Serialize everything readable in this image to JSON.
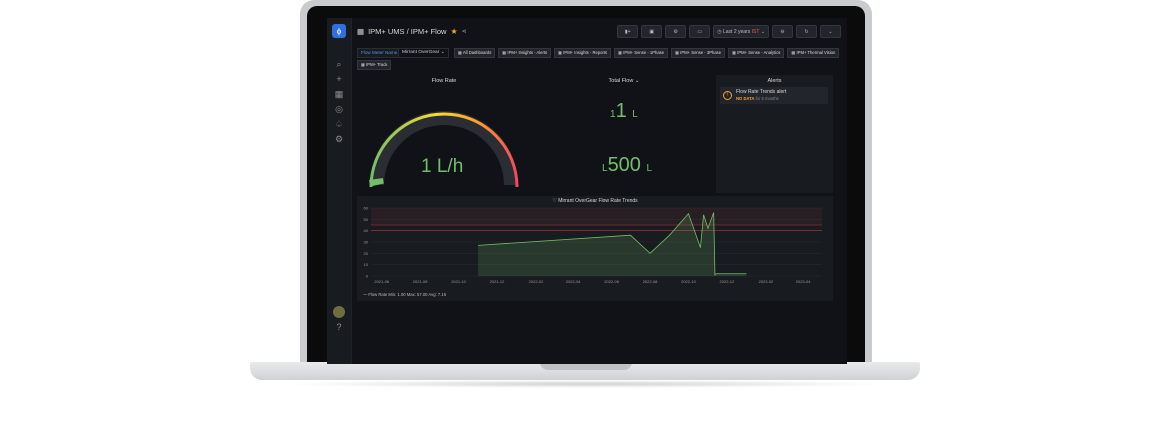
{
  "header": {
    "breadcrumb": "IPM+ UMS / IPM+ Flow",
    "time_range": "Last 2 years",
    "time_zone": "IST"
  },
  "variables": {
    "label": "Flow Meter Name",
    "value": "Mirrant OverGear"
  },
  "links": [
    "All Dashboards",
    "IPM+ Insights - Alerts",
    "IPM+ Insights - Reports",
    "IPM+ Sense - 1Phase",
    "IPM+ Sense - 3Phase",
    "IPM+ Sense - Analytics",
    "IPM+ Thermal Vision"
  ],
  "links_row2": [
    "IPM+ Track"
  ],
  "panels": {
    "gauge": {
      "title": "Flow Rate",
      "value": "1 L/h"
    },
    "total_flow": {
      "title": "Total Flow",
      "value1_prefix": "1",
      "value1": "1",
      "value1_unit": "L",
      "value2_prefix": "L",
      "value2": "500",
      "value2_unit": "L"
    },
    "alerts": {
      "title": "Alerts",
      "item_title": "Flow Rate Trends alert",
      "item_state": "NO DATA",
      "item_age": "for 6 months"
    }
  },
  "chart_data": {
    "type": "line",
    "title": "Mirrant OverGear Flow Rate Trends",
    "y_ticks": [
      "60",
      "50",
      "40",
      "30",
      "20",
      "10",
      "0"
    ],
    "x_ticks": [
      "2021-06",
      "2021-08",
      "2021-10",
      "2021-12",
      "2022-02",
      "2022-04",
      "2022-06",
      "2022-08",
      "2022-10",
      "2022-12",
      "2023-02",
      "2023-04"
    ],
    "ylim": [
      0,
      60
    ],
    "series": [
      {
        "name": "Flow Rate",
        "x": [
          "2021-11",
          "2022-07",
          "2022-08",
          "2022-09",
          "2022-10",
          "2022-10-20",
          "2022-10-25",
          "2022-11",
          "2022-11-10",
          "2022-11-12",
          "2022-11-14",
          "2023-01"
        ],
        "values": [
          27,
          36,
          20,
          36,
          55,
          25,
          54,
          42,
          56,
          1,
          2,
          2
        ]
      }
    ],
    "legend": "Flow Rate  Min: 1.00  Max: 57.00  Avg: 7.16",
    "thresholds": [
      45,
      40
    ]
  }
}
